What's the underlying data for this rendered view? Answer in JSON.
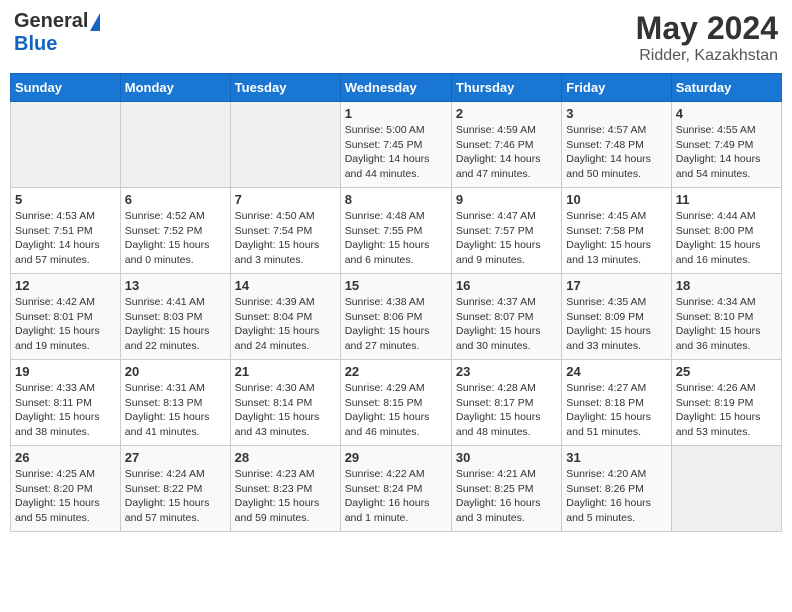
{
  "logo": {
    "general": "General",
    "blue": "Blue"
  },
  "title": {
    "month_year": "May 2024",
    "location": "Ridder, Kazakhstan"
  },
  "days_of_week": [
    "Sunday",
    "Monday",
    "Tuesday",
    "Wednesday",
    "Thursday",
    "Friday",
    "Saturday"
  ],
  "weeks": [
    [
      {
        "day": "",
        "info": ""
      },
      {
        "day": "",
        "info": ""
      },
      {
        "day": "",
        "info": ""
      },
      {
        "day": "1",
        "info": "Sunrise: 5:00 AM\nSunset: 7:45 PM\nDaylight: 14 hours\nand 44 minutes."
      },
      {
        "day": "2",
        "info": "Sunrise: 4:59 AM\nSunset: 7:46 PM\nDaylight: 14 hours\nand 47 minutes."
      },
      {
        "day": "3",
        "info": "Sunrise: 4:57 AM\nSunset: 7:48 PM\nDaylight: 14 hours\nand 50 minutes."
      },
      {
        "day": "4",
        "info": "Sunrise: 4:55 AM\nSunset: 7:49 PM\nDaylight: 14 hours\nand 54 minutes."
      }
    ],
    [
      {
        "day": "5",
        "info": "Sunrise: 4:53 AM\nSunset: 7:51 PM\nDaylight: 14 hours\nand 57 minutes."
      },
      {
        "day": "6",
        "info": "Sunrise: 4:52 AM\nSunset: 7:52 PM\nDaylight: 15 hours\nand 0 minutes."
      },
      {
        "day": "7",
        "info": "Sunrise: 4:50 AM\nSunset: 7:54 PM\nDaylight: 15 hours\nand 3 minutes."
      },
      {
        "day": "8",
        "info": "Sunrise: 4:48 AM\nSunset: 7:55 PM\nDaylight: 15 hours\nand 6 minutes."
      },
      {
        "day": "9",
        "info": "Sunrise: 4:47 AM\nSunset: 7:57 PM\nDaylight: 15 hours\nand 9 minutes."
      },
      {
        "day": "10",
        "info": "Sunrise: 4:45 AM\nSunset: 7:58 PM\nDaylight: 15 hours\nand 13 minutes."
      },
      {
        "day": "11",
        "info": "Sunrise: 4:44 AM\nSunset: 8:00 PM\nDaylight: 15 hours\nand 16 minutes."
      }
    ],
    [
      {
        "day": "12",
        "info": "Sunrise: 4:42 AM\nSunset: 8:01 PM\nDaylight: 15 hours\nand 19 minutes."
      },
      {
        "day": "13",
        "info": "Sunrise: 4:41 AM\nSunset: 8:03 PM\nDaylight: 15 hours\nand 22 minutes."
      },
      {
        "day": "14",
        "info": "Sunrise: 4:39 AM\nSunset: 8:04 PM\nDaylight: 15 hours\nand 24 minutes."
      },
      {
        "day": "15",
        "info": "Sunrise: 4:38 AM\nSunset: 8:06 PM\nDaylight: 15 hours\nand 27 minutes."
      },
      {
        "day": "16",
        "info": "Sunrise: 4:37 AM\nSunset: 8:07 PM\nDaylight: 15 hours\nand 30 minutes."
      },
      {
        "day": "17",
        "info": "Sunrise: 4:35 AM\nSunset: 8:09 PM\nDaylight: 15 hours\nand 33 minutes."
      },
      {
        "day": "18",
        "info": "Sunrise: 4:34 AM\nSunset: 8:10 PM\nDaylight: 15 hours\nand 36 minutes."
      }
    ],
    [
      {
        "day": "19",
        "info": "Sunrise: 4:33 AM\nSunset: 8:11 PM\nDaylight: 15 hours\nand 38 minutes."
      },
      {
        "day": "20",
        "info": "Sunrise: 4:31 AM\nSunset: 8:13 PM\nDaylight: 15 hours\nand 41 minutes."
      },
      {
        "day": "21",
        "info": "Sunrise: 4:30 AM\nSunset: 8:14 PM\nDaylight: 15 hours\nand 43 minutes."
      },
      {
        "day": "22",
        "info": "Sunrise: 4:29 AM\nSunset: 8:15 PM\nDaylight: 15 hours\nand 46 minutes."
      },
      {
        "day": "23",
        "info": "Sunrise: 4:28 AM\nSunset: 8:17 PM\nDaylight: 15 hours\nand 48 minutes."
      },
      {
        "day": "24",
        "info": "Sunrise: 4:27 AM\nSunset: 8:18 PM\nDaylight: 15 hours\nand 51 minutes."
      },
      {
        "day": "25",
        "info": "Sunrise: 4:26 AM\nSunset: 8:19 PM\nDaylight: 15 hours\nand 53 minutes."
      }
    ],
    [
      {
        "day": "26",
        "info": "Sunrise: 4:25 AM\nSunset: 8:20 PM\nDaylight: 15 hours\nand 55 minutes."
      },
      {
        "day": "27",
        "info": "Sunrise: 4:24 AM\nSunset: 8:22 PM\nDaylight: 15 hours\nand 57 minutes."
      },
      {
        "day": "28",
        "info": "Sunrise: 4:23 AM\nSunset: 8:23 PM\nDaylight: 15 hours\nand 59 minutes."
      },
      {
        "day": "29",
        "info": "Sunrise: 4:22 AM\nSunset: 8:24 PM\nDaylight: 16 hours\nand 1 minute."
      },
      {
        "day": "30",
        "info": "Sunrise: 4:21 AM\nSunset: 8:25 PM\nDaylight: 16 hours\nand 3 minutes."
      },
      {
        "day": "31",
        "info": "Sunrise: 4:20 AM\nSunset: 8:26 PM\nDaylight: 16 hours\nand 5 minutes."
      },
      {
        "day": "",
        "info": ""
      }
    ]
  ]
}
